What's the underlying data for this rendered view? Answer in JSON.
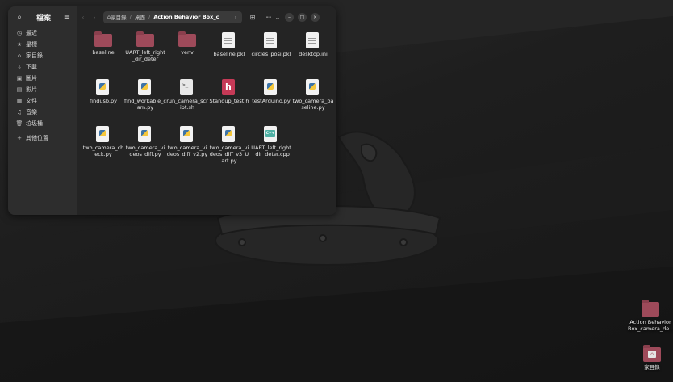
{
  "sidebar": {
    "title": "檔案",
    "items": [
      {
        "icon": "clock-icon",
        "glyph": "◷",
        "label": "最近"
      },
      {
        "icon": "star-icon",
        "glyph": "★",
        "label": "星標"
      },
      {
        "icon": "home-icon",
        "glyph": "⌂",
        "label": "家目錄"
      },
      {
        "icon": "download-icon",
        "glyph": "⇩",
        "label": "下載"
      },
      {
        "icon": "picture-icon",
        "glyph": "▣",
        "label": "圖片"
      },
      {
        "icon": "video-icon",
        "glyph": "▤",
        "label": "影片"
      },
      {
        "icon": "document-icon",
        "glyph": "▦",
        "label": "文件"
      },
      {
        "icon": "music-icon",
        "glyph": "♫",
        "label": "音樂"
      },
      {
        "icon": "trash-icon",
        "glyph": "🗑",
        "label": "垃圾桶"
      },
      {
        "icon": "plus-icon",
        "glyph": "+",
        "label": "其他位置"
      }
    ]
  },
  "pathbar": {
    "home": "家目錄",
    "desktop": "桌面",
    "current": "Action Behavior Box_c"
  },
  "files": [
    {
      "name": "baseline",
      "type": "folder"
    },
    {
      "name": "UART_left_right_dir_deter",
      "type": "folder"
    },
    {
      "name": "venv",
      "type": "folder"
    },
    {
      "name": "baseline.pkl",
      "type": "bin"
    },
    {
      "name": "circles_posi.pkl",
      "type": "bin"
    },
    {
      "name": "desktop.ini",
      "type": "bin"
    },
    {
      "name": "findusb.py",
      "type": "py"
    },
    {
      "name": "find_workable_cam.py",
      "type": "py"
    },
    {
      "name": "run_camera_script.sh",
      "type": "sh"
    },
    {
      "name": "Standup_test.h",
      "type": "h"
    },
    {
      "name": "testArduino.py",
      "type": "py"
    },
    {
      "name": "two_camera_baseline.py",
      "type": "py"
    },
    {
      "name": "two_camera_check.py",
      "type": "py"
    },
    {
      "name": "two_camera_videos_diff.py",
      "type": "py"
    },
    {
      "name": "two_camera_videos_diff_v2.py",
      "type": "py"
    },
    {
      "name": "two_camera_videos_diff_v3_Uart.py",
      "type": "py"
    },
    {
      "name": "UART_left_right_dir_deter.cpp",
      "type": "cpp"
    }
  ],
  "desktop": {
    "folder_label": "Action Behavior Box_camera_de...",
    "home_label": "家目錄"
  }
}
